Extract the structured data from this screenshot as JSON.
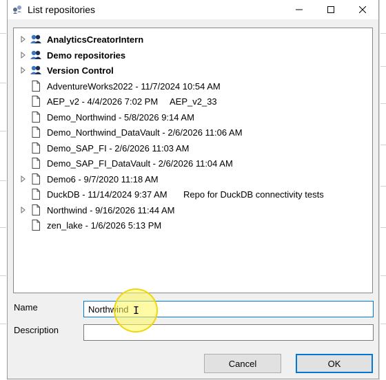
{
  "window": {
    "title": "List repositories",
    "controls": [
      "minimize-icon",
      "maximize-icon",
      "close-icon"
    ]
  },
  "repositories": [
    {
      "label": "AnalyticsCreatorIntern",
      "bold": true,
      "expandable": true,
      "icon": "users-group-icon",
      "description": ""
    },
    {
      "label": "Demo repositories",
      "bold": true,
      "expandable": true,
      "icon": "users-group-icon",
      "description": ""
    },
    {
      "label": "Version Control",
      "bold": true,
      "expandable": true,
      "icon": "users-group-icon",
      "description": ""
    },
    {
      "label": "AdventureWorks2022 - 11/7/2024 10:54 AM",
      "bold": false,
      "expandable": false,
      "icon": "document-icon",
      "description": ""
    },
    {
      "label": "AEP_v2 - 4/4/2026 7:02 PM",
      "bold": false,
      "expandable": false,
      "icon": "document-icon",
      "description": "AEP_v2_33"
    },
    {
      "label": "Demo_Northwind - 5/8/2026 9:14 AM",
      "bold": false,
      "expandable": false,
      "icon": "document-icon",
      "description": ""
    },
    {
      "label": "Demo_Northwind_DataVault - 2/6/2026 11:06 AM",
      "bold": false,
      "expandable": false,
      "icon": "document-icon",
      "description": ""
    },
    {
      "label": "Demo_SAP_FI - 2/6/2026 11:03 AM",
      "bold": false,
      "expandable": false,
      "icon": "document-icon",
      "description": ""
    },
    {
      "label": "Demo_SAP_FI_DataVault - 2/6/2026 11:04 AM",
      "bold": false,
      "expandable": false,
      "icon": "document-icon",
      "description": ""
    },
    {
      "label": "Demo6 - 9/7/2020 11:18 AM",
      "bold": false,
      "expandable": true,
      "icon": "document-icon",
      "description": ""
    },
    {
      "label": "DuckDB - 11/14/2024 9:37 AM",
      "bold": false,
      "expandable": false,
      "icon": "document-icon",
      "description": "Repo for DuckDB connectivity tests"
    },
    {
      "label": "Northwind - 9/16/2026 11:44 AM",
      "bold": false,
      "expandable": true,
      "icon": "document-icon",
      "description": ""
    },
    {
      "label": "zen_lake - 1/6/2026 5:13 PM",
      "bold": false,
      "expandable": false,
      "icon": "document-icon",
      "description": ""
    }
  ],
  "form": {
    "name_label": "Name",
    "name_value": "Northwind",
    "description_label": "Description",
    "description_value": ""
  },
  "buttons": {
    "cancel": "Cancel",
    "ok": "OK"
  },
  "colors": {
    "accent": "#0078d7",
    "cursor_highlight": "#fff55a"
  }
}
